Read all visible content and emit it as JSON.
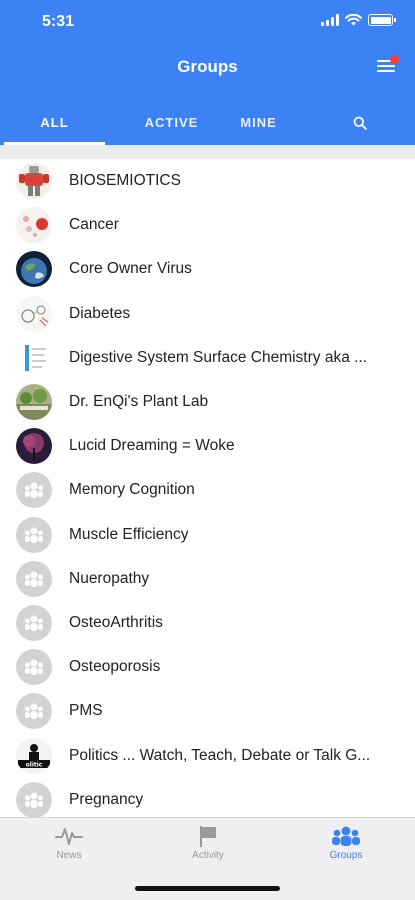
{
  "status_bar": {
    "time": "5:31"
  },
  "header": {
    "title": "Groups"
  },
  "tabs": [
    {
      "label": "ALL",
      "active": true
    },
    {
      "label": "ACTIVE",
      "active": false
    },
    {
      "label": "MINE",
      "active": false
    }
  ],
  "groups": [
    {
      "name": "BIOSEMIOTICS",
      "avatar": "robot-image"
    },
    {
      "name": "Cancer",
      "avatar": "cancer-image"
    },
    {
      "name": "Core Owner Virus",
      "avatar": "earth-image"
    },
    {
      "name": "Diabetes",
      "avatar": "diagram-image"
    },
    {
      "name": "Digestive System Surface Chemistry aka ...",
      "avatar": "chart-image"
    },
    {
      "name": "Dr. EnQi's Plant Lab",
      "avatar": "plants-image"
    },
    {
      "name": "Lucid Dreaming = Woke",
      "avatar": "tree-image"
    },
    {
      "name": "Memory Cognition",
      "avatar": "group-placeholder-icon"
    },
    {
      "name": "Muscle Efficiency",
      "avatar": "group-placeholder-icon"
    },
    {
      "name": "Nueropathy",
      "avatar": "group-placeholder-icon"
    },
    {
      "name": "OsteoArthritis",
      "avatar": "group-placeholder-icon"
    },
    {
      "name": "Osteoporosis",
      "avatar": "group-placeholder-icon"
    },
    {
      "name": "PMS",
      "avatar": "group-placeholder-icon"
    },
    {
      "name": "Politics ... Watch, Teach, Debate or Talk G...",
      "avatar": "politics-image"
    },
    {
      "name": "Pregnancy",
      "avatar": "group-placeholder-icon"
    }
  ],
  "tabbar": [
    {
      "label": "News",
      "icon": "pulse-icon",
      "active": false
    },
    {
      "label": "Activity",
      "icon": "flag-icon",
      "active": false
    },
    {
      "label": "Groups",
      "icon": "groups-icon",
      "active": true
    }
  ],
  "colors": {
    "accent": "#3d82f5",
    "notification": "#ff3b30",
    "placeholder": "#d3d3d6"
  }
}
